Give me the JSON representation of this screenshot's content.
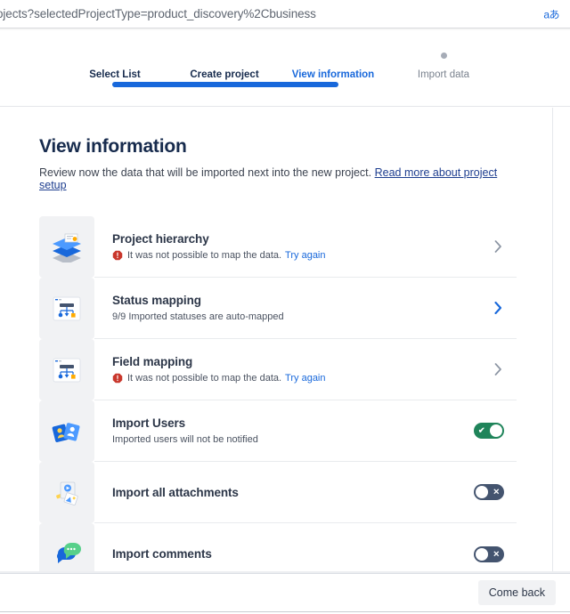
{
  "browser": {
    "url": "ojects?selectedProjectType=product_discovery%2Cbusiness",
    "translate_icon_label": "aあ",
    "translate_icon_name": "translate-icon"
  },
  "stepper": {
    "steps": [
      {
        "label": "Select List",
        "state": "done"
      },
      {
        "label": "Create project",
        "state": "done"
      },
      {
        "label": "View information",
        "state": "current"
      },
      {
        "label": "Import data",
        "state": "todo"
      }
    ],
    "progress_color": "#1868db",
    "inactive_dot_color": "#a6acb7"
  },
  "page": {
    "title": "View information",
    "description": "Review now the data that will be imported next into the new project.",
    "description_link": "Read more about project setup"
  },
  "rows": [
    {
      "title": "Project hierarchy",
      "icon": "layers-icon",
      "status_type": "error",
      "status_text": "It was not possible to map the data.",
      "status_link": "Try again",
      "control": "chevron",
      "chevron_state": "disabled"
    },
    {
      "title": "Status mapping",
      "icon": "status-mapping-icon",
      "status_type": "info",
      "status_text": "9/9 Imported statuses are auto-mapped",
      "status_link": "",
      "control": "chevron",
      "chevron_state": "active"
    },
    {
      "title": "Field mapping",
      "icon": "field-mapping-icon",
      "status_type": "error",
      "status_text": "It was not possible to map the data.",
      "status_link": "Try again",
      "control": "chevron",
      "chevron_state": "disabled"
    },
    {
      "title": "Import Users",
      "icon": "users-cards-icon",
      "status_type": "info",
      "status_text": "Imported users will not be notified",
      "status_link": "",
      "control": "toggle",
      "toggle_state": "on",
      "toggle_mark": "✔"
    },
    {
      "title": "Import all attachments",
      "icon": "attachments-icon",
      "status_type": "none",
      "status_text": "",
      "status_link": "",
      "control": "toggle",
      "toggle_state": "off",
      "toggle_mark": "✕"
    },
    {
      "title": "Import comments",
      "icon": "comments-icon",
      "status_type": "none",
      "status_text": "",
      "status_link": "",
      "control": "toggle",
      "toggle_state": "off",
      "toggle_mark": "✕"
    }
  ],
  "footer": {
    "back_button": "Come back"
  },
  "colors": {
    "accent_blue": "#1868db",
    "error_red": "#c9372c",
    "toggle_on_green": "#1f845a",
    "toggle_off_slate": "#44546f",
    "tile_grey": "#f1f2f4"
  }
}
